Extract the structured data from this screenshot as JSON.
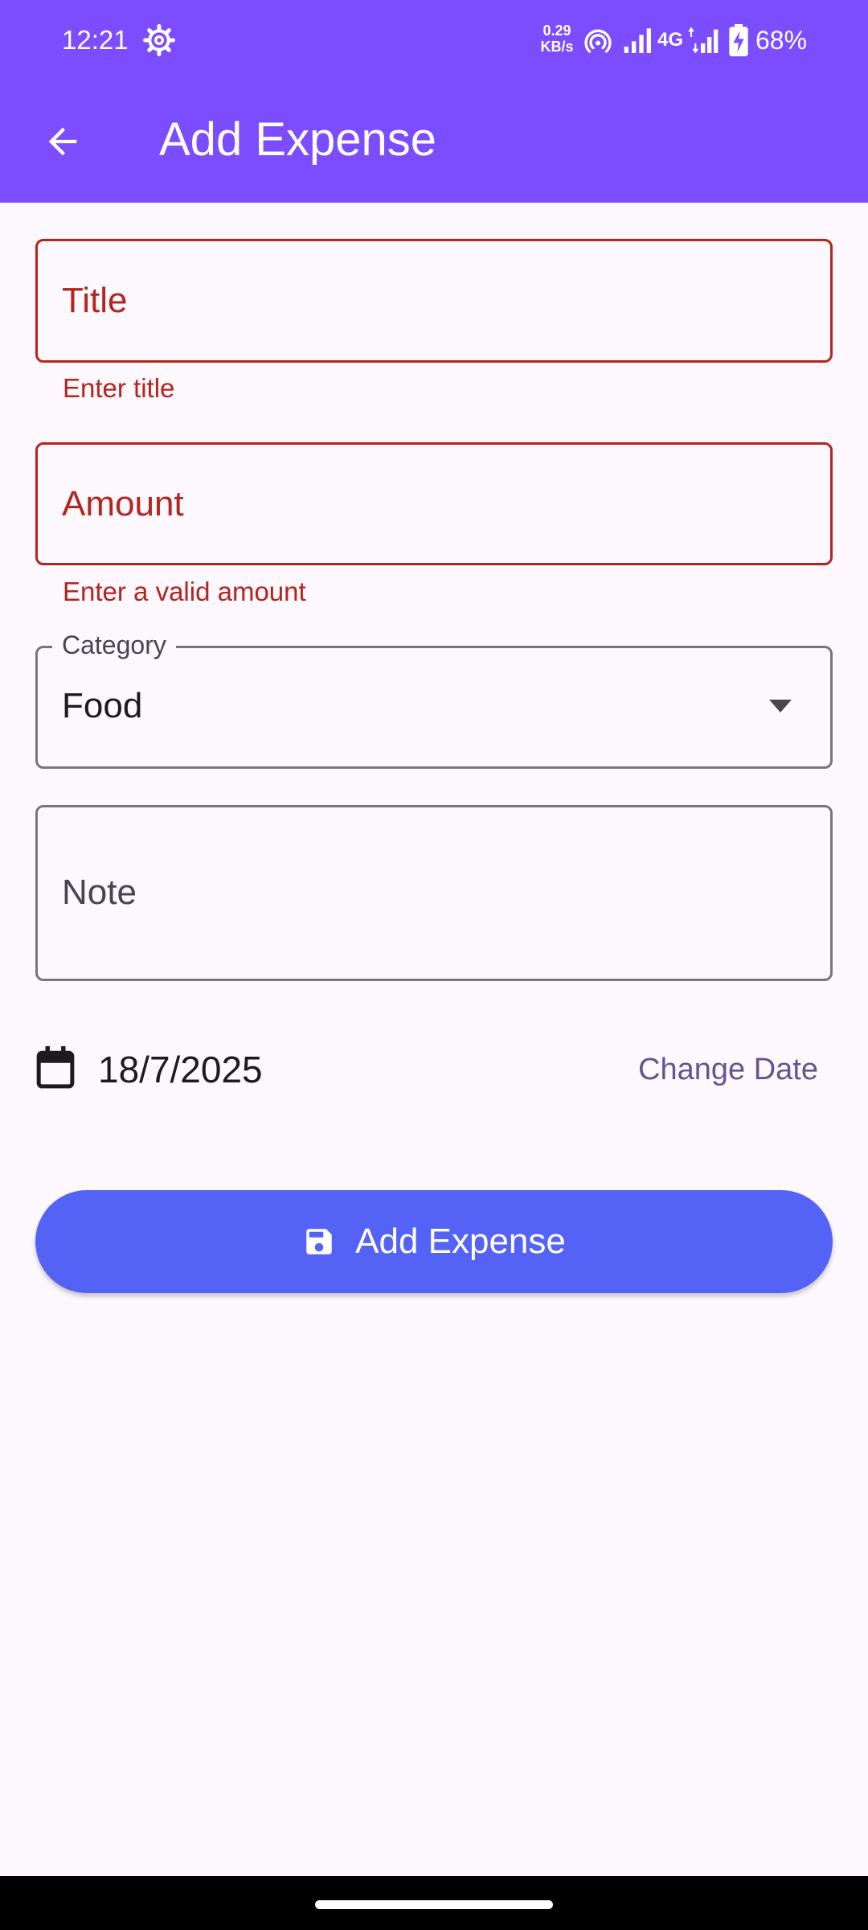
{
  "status_bar": {
    "time": "12:21",
    "net_speed_value": "0.29",
    "net_speed_unit": "KB/s",
    "network_type": "4G",
    "battery": "68%"
  },
  "app_bar": {
    "title": "Add Expense",
    "back_icon": "arrow-back-icon"
  },
  "form": {
    "title_field": {
      "label": "Title",
      "error": "Enter title"
    },
    "amount_field": {
      "label": "Amount",
      "error": "Enter a valid amount"
    },
    "category_field": {
      "label": "Category",
      "value": "Food"
    },
    "note_field": {
      "label": "Note"
    },
    "date": {
      "value": "18/7/2025",
      "change_label": "Change Date"
    },
    "submit": {
      "label": "Add Expense",
      "icon": "save-icon"
    }
  },
  "colors": {
    "primary": "#7c4dff",
    "button": "#5462f6",
    "error": "#b3261e",
    "background": "#fdf7fe",
    "text_button": "#65558f"
  }
}
